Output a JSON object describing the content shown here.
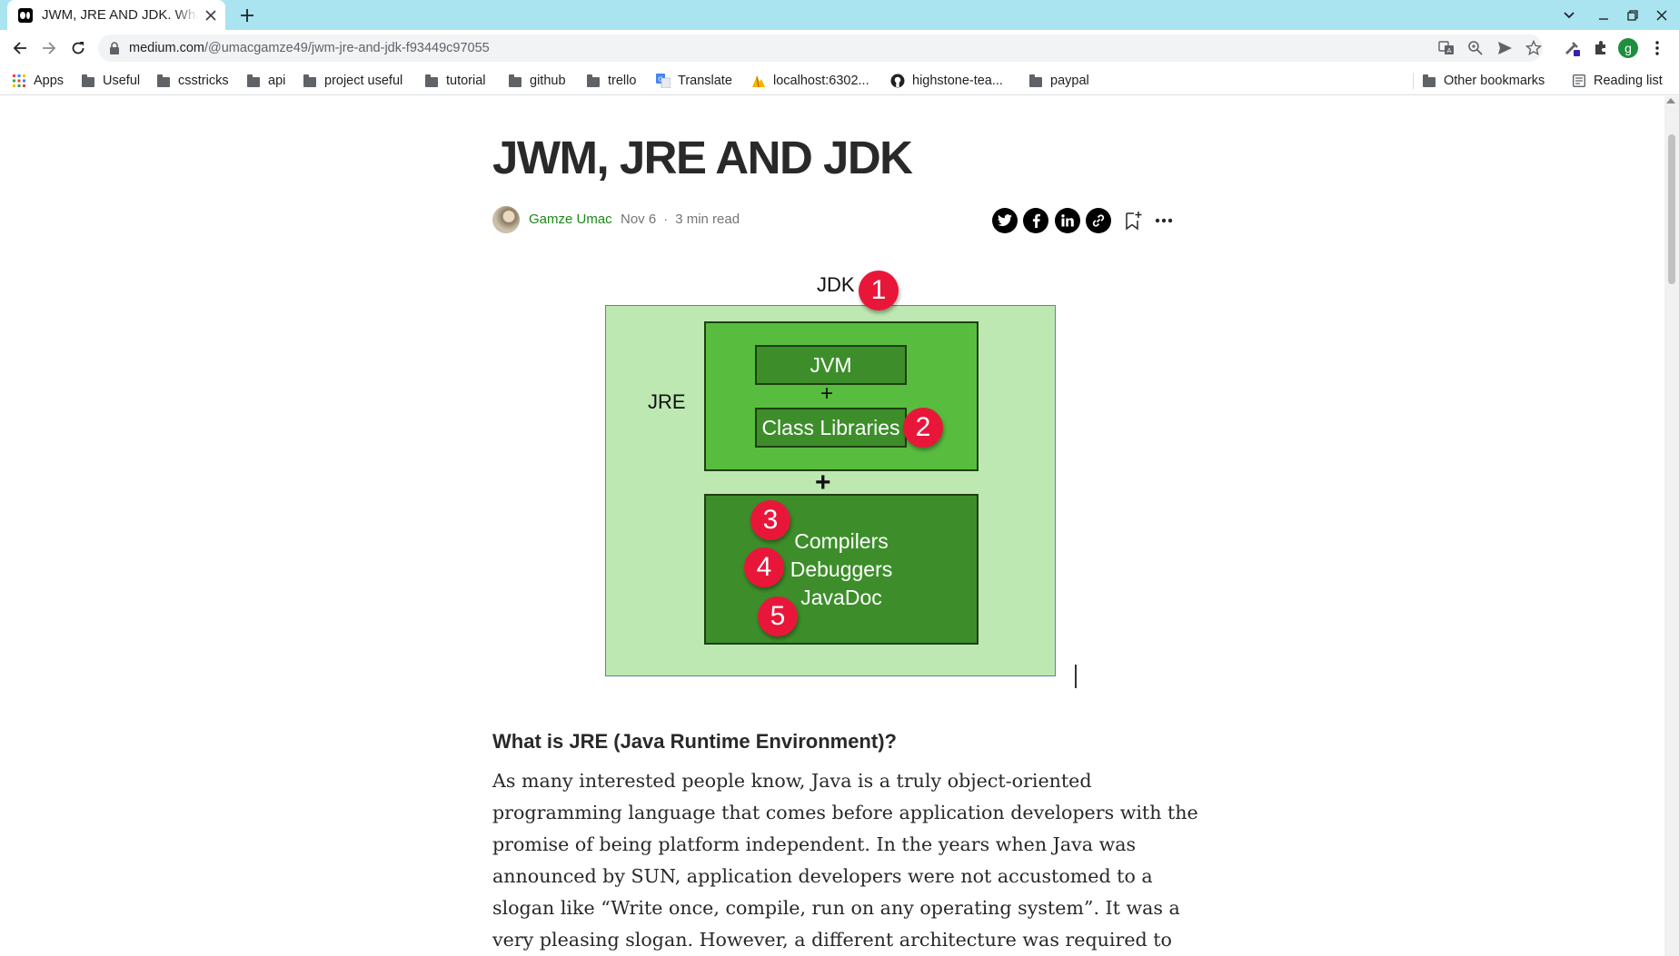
{
  "browser": {
    "tab": {
      "title": "JWM, JRE AND JDK. What is JRE",
      "favicon": "medium-icon"
    },
    "url": {
      "host": "medium.com",
      "path": "/@umacgamze49/jwm-jre-and-jdk-f93449c97055"
    },
    "profile_initial": "g",
    "bookmarks": [
      {
        "label": "Apps",
        "icon": "apps-grid-icon"
      },
      {
        "label": "Useful",
        "icon": "folder-icon"
      },
      {
        "label": "csstricks",
        "icon": "folder-icon"
      },
      {
        "label": "api",
        "icon": "folder-icon"
      },
      {
        "label": "project useful",
        "icon": "folder-icon"
      },
      {
        "label": "tutorial",
        "icon": "folder-icon"
      },
      {
        "label": "github",
        "icon": "folder-icon"
      },
      {
        "label": "trello",
        "icon": "folder-icon"
      },
      {
        "label": "Translate",
        "icon": "google-translate-icon"
      },
      {
        "label": "localhost:6302...",
        "icon": "localhost-icon"
      },
      {
        "label": "highstone-tea...",
        "icon": "github-icon"
      },
      {
        "label": "paypal",
        "icon": "folder-icon"
      }
    ],
    "other_bookmarks": "Other bookmarks",
    "reading_list": "Reading list",
    "colors": {
      "tab_strip": "#a9e4f0",
      "omnibox": "#f1f3f4",
      "profile": "#1e8e3e"
    }
  },
  "article": {
    "title": "JWM, JRE AND JDK",
    "author": "Gamze Umac",
    "date": "Nov 6",
    "separator": "·",
    "read_time": "3 min read",
    "share_icons": [
      "twitter-icon",
      "facebook-icon",
      "linkedin-icon",
      "link-icon",
      "bookmark-add-icon",
      "more-icon"
    ],
    "figure": {
      "jdk_label": "JDK",
      "jre_label": "JRE",
      "jvm": "JVM",
      "plus": "+",
      "class_libraries": "Class Libraries",
      "tools": [
        "Compilers",
        "Debuggers",
        "JavaDoc"
      ],
      "badges": [
        "1",
        "2",
        "3",
        "4",
        "5"
      ],
      "colors": {
        "outer": "#bde8b1",
        "jre_box": "#58bd3e",
        "dark_box": "#3d8e2a",
        "badge": "#e8173a"
      }
    },
    "section_heading": "What is JRE (Java Runtime Environment)?",
    "body_lines": [
      "As many interested people know, Java is a truly object-oriented",
      "programming language that comes before application developers with the",
      "promise of being platform independent. In the years when Java was",
      "announced by SUN, application developers were not accustomed to a",
      "slogan like “Write once, compile, run on any operating system”. It was a",
      "very pleasing slogan. However, a different architecture was required to"
    ],
    "colors": {
      "author": "#1a8917",
      "text": "#292929"
    }
  }
}
